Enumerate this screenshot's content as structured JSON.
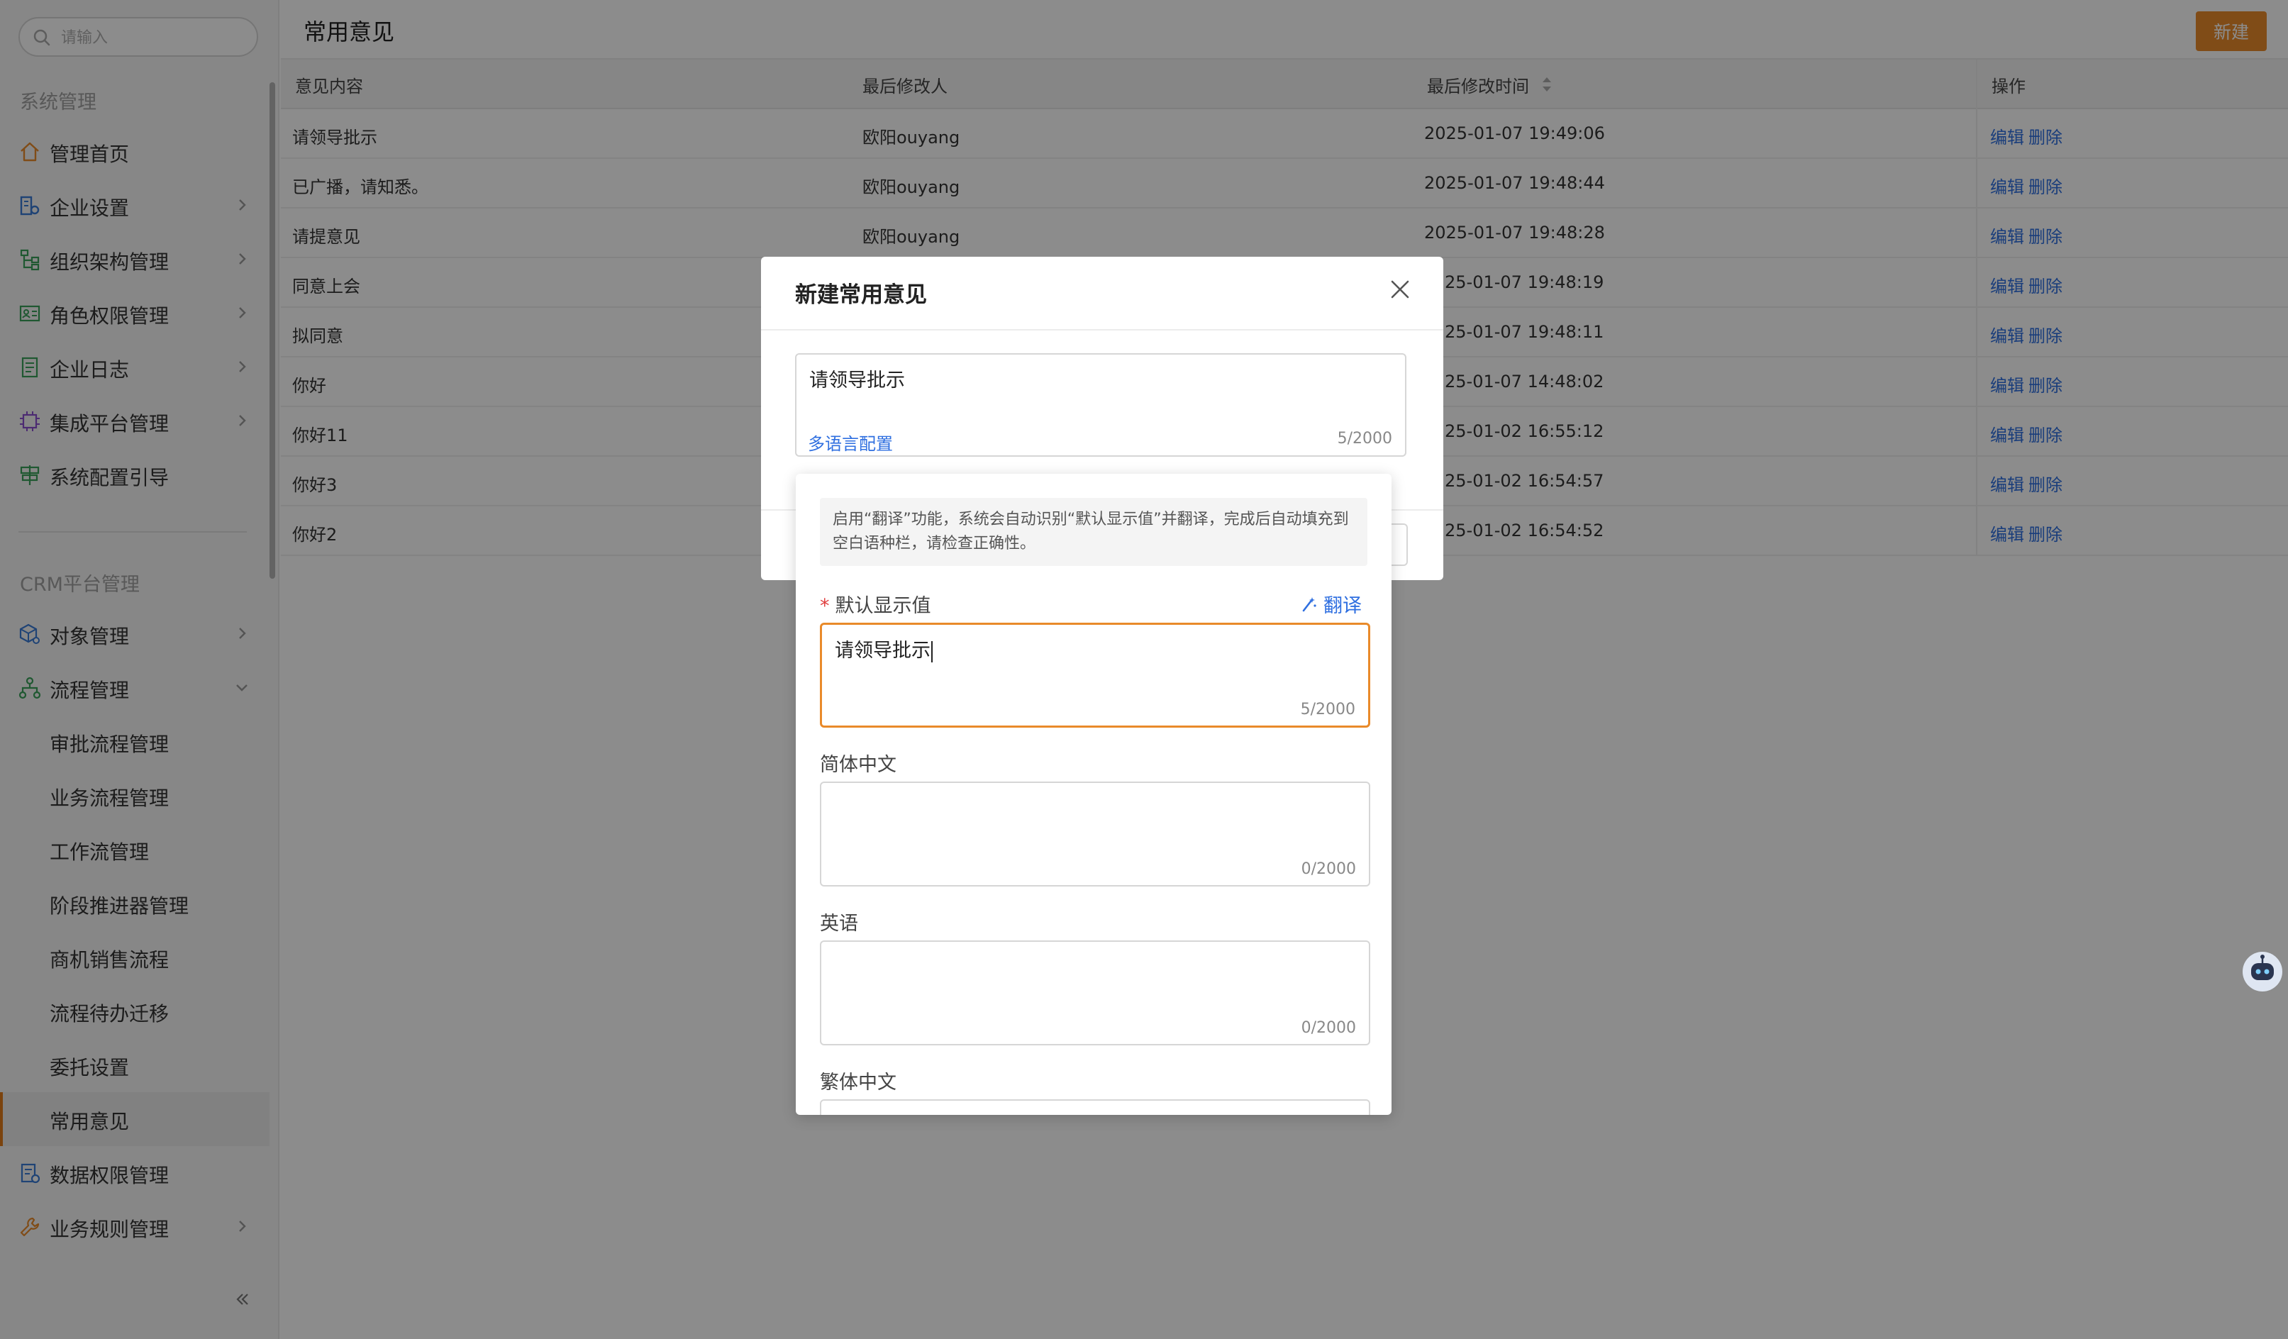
{
  "sidebar": {
    "search_placeholder": "请输入",
    "section1_title": "系统管理",
    "section2_title": "CRM平台管理",
    "items": [
      {
        "label": "管理首页",
        "icon": "home-icon"
      },
      {
        "label": "企业设置",
        "icon": "building-settings-icon"
      },
      {
        "label": "组织架构管理",
        "icon": "org-tree-icon"
      },
      {
        "label": "角色权限管理",
        "icon": "id-card-icon"
      },
      {
        "label": "企业日志",
        "icon": "log-icon"
      },
      {
        "label": "集成平台管理",
        "icon": "chip-icon"
      },
      {
        "label": "系统配置引导",
        "icon": "signpost-icon"
      },
      {
        "label": "对象管理",
        "icon": "cube-settings-icon"
      },
      {
        "label": "流程管理",
        "icon": "flow-icon"
      },
      {
        "label": "审批流程管理"
      },
      {
        "label": "业务流程管理"
      },
      {
        "label": "工作流管理"
      },
      {
        "label": "阶段推进器管理"
      },
      {
        "label": "商机销售流程"
      },
      {
        "label": "流程待办迁移"
      },
      {
        "label": "委托设置"
      },
      {
        "label": "常用意见"
      },
      {
        "label": "数据权限管理",
        "icon": "data-permission-icon"
      },
      {
        "label": "业务规则管理",
        "icon": "wrench-icon"
      }
    ]
  },
  "header": {
    "title": "常用意见",
    "new_button": "新建"
  },
  "table": {
    "columns": [
      "意见内容",
      "最后修改人",
      "最后修改时间",
      "操作"
    ],
    "edit_label": "编辑",
    "delete_label": "删除",
    "rows": [
      {
        "content": "请领导批示",
        "modifier": "欧阳ouyang",
        "time": "2025-01-07 19:49:06"
      },
      {
        "content": "已广播，请知悉。",
        "modifier": "欧阳ouyang",
        "time": "2025-01-07 19:48:44"
      },
      {
        "content": "请提意见",
        "modifier": "欧阳ouyang",
        "time": "2025-01-07 19:48:28"
      },
      {
        "content": "同意上会",
        "modifier": "",
        "time": "25-01-07 19:48:19"
      },
      {
        "content": "拟同意",
        "modifier": "",
        "time": "25-01-07 19:48:11"
      },
      {
        "content": "你好",
        "modifier": "",
        "time": "25-01-07 14:48:02"
      },
      {
        "content": "你好11",
        "modifier": "",
        "time": "25-01-02 16:55:12"
      },
      {
        "content": "你好3",
        "modifier": "",
        "time": "25-01-02 16:54:57"
      },
      {
        "content": "你好2",
        "modifier": "",
        "time": "25-01-02 16:54:52"
      }
    ]
  },
  "modal": {
    "title": "新建常用意见",
    "value": "请领导批示",
    "multilang_link": "多语言配置",
    "count": "5/2000"
  },
  "popover": {
    "tip": "启用“翻译”功能，系统会自动识别“默认显示值”并翻译，完成后自动填充到空白语种栏，请检查正确性。",
    "translate_label": "翻译",
    "fields": [
      {
        "label": "默认显示值",
        "required": "*",
        "value": "请领导批示",
        "count": "5/2000"
      },
      {
        "label": "简体中文",
        "value": "",
        "count": "0/2000"
      },
      {
        "label": "英语",
        "value": "",
        "count": "0/2000"
      },
      {
        "label": "繁体中文",
        "value": "",
        "count": ""
      }
    ]
  },
  "colors": {
    "accent": "#e98a2a",
    "link": "#2f6fe0"
  }
}
